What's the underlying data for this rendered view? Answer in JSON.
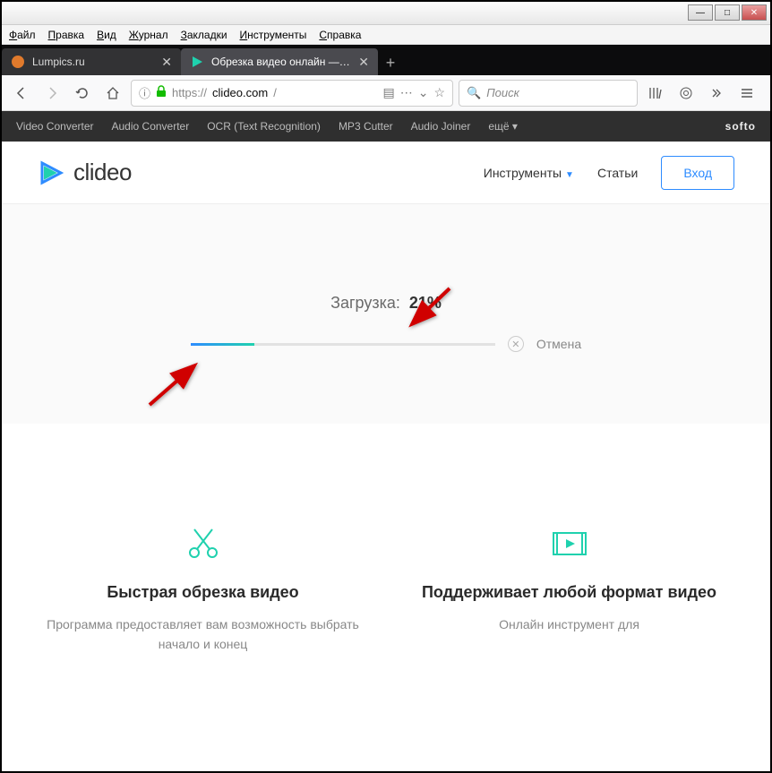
{
  "window": {
    "menu": [
      "Файл",
      "Правка",
      "Вид",
      "Журнал",
      "Закладки",
      "Инструменты",
      "Справка"
    ]
  },
  "tabs": [
    {
      "label": "Lumpics.ru",
      "active": false
    },
    {
      "label": "Обрезка видео онлайн — Обр",
      "active": true
    }
  ],
  "url": {
    "protocol": "https://",
    "domain": "clideo.com",
    "path": "/"
  },
  "search": {
    "placeholder": "Поиск"
  },
  "darknav": {
    "items": [
      "Video Converter",
      "Audio Converter",
      "OCR (Text Recognition)",
      "MP3 Cutter",
      "Audio Joiner",
      "ещё ▾"
    ],
    "brand": "softo"
  },
  "site": {
    "logo": "clideo",
    "nav": {
      "tools": "Инструменты",
      "articles": "Статьи",
      "login": "Вход"
    }
  },
  "upload": {
    "label": "Загрузка:",
    "percent": "21%",
    "percent_value": 21,
    "cancel": "Отмена"
  },
  "features": [
    {
      "title": "Быстрая обрезка видео",
      "desc": "Программа предоставляет вам возможность выбрать начало и конец"
    },
    {
      "title": "Поддерживает любой формат видео",
      "desc": "Онлайн инструмент для"
    }
  ]
}
